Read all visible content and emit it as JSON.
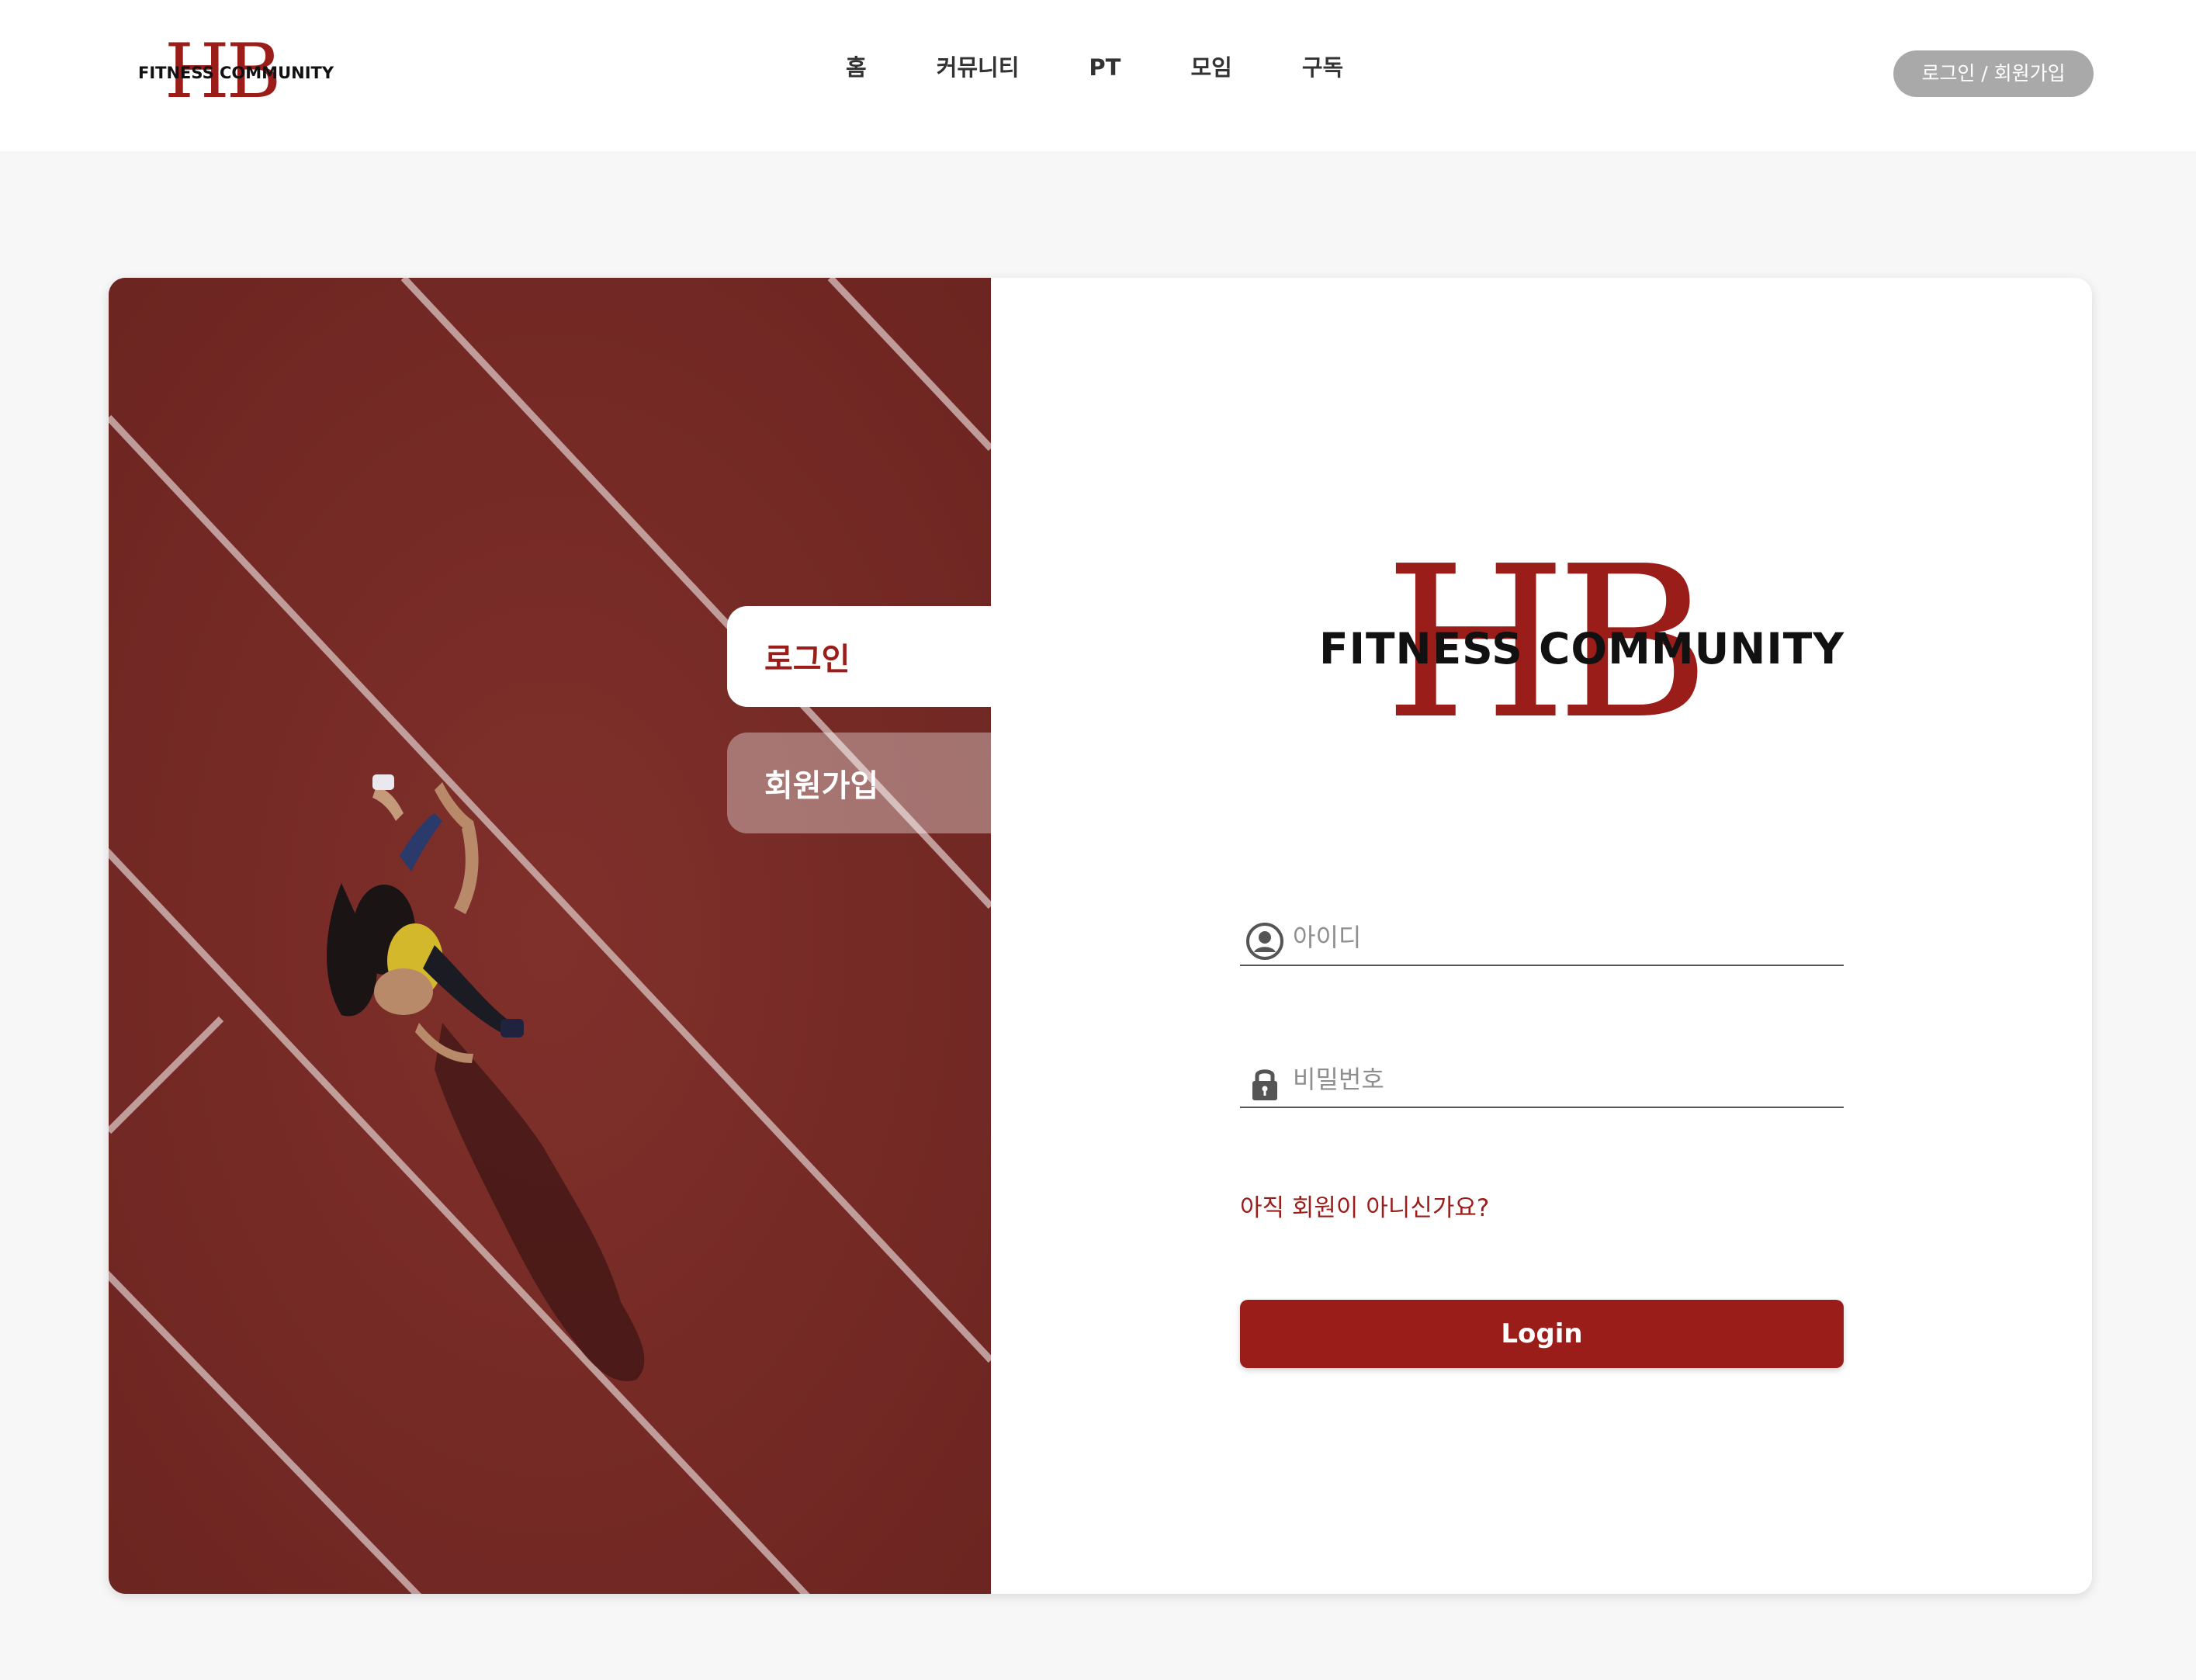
{
  "header": {
    "logo": {
      "letters": "HB",
      "text": "FITNESS COMMUNITY"
    },
    "nav": [
      {
        "label": "홈"
      },
      {
        "label": "커뮤니티"
      },
      {
        "label": "PT"
      },
      {
        "label": "모임"
      },
      {
        "label": "구독"
      }
    ],
    "auth_button": "로그인 / 회원가입"
  },
  "tabs": {
    "login": "로그인",
    "signup": "회원가입"
  },
  "form": {
    "logo": {
      "letters": "HB",
      "text": "FITNESS COMMUNITY"
    },
    "id_field": {
      "placeholder": "아이디",
      "icon": "user-circle-icon"
    },
    "password_field": {
      "placeholder": "비밀번호",
      "icon": "lock-icon"
    },
    "signup_link": "아직 회원이 아니신가요?",
    "login_button": "Login"
  },
  "colors": {
    "brand": "#9a1d1a",
    "track": "#7a2a26",
    "background": "#f7f7f7",
    "auth_button": "#a9a9a9"
  }
}
